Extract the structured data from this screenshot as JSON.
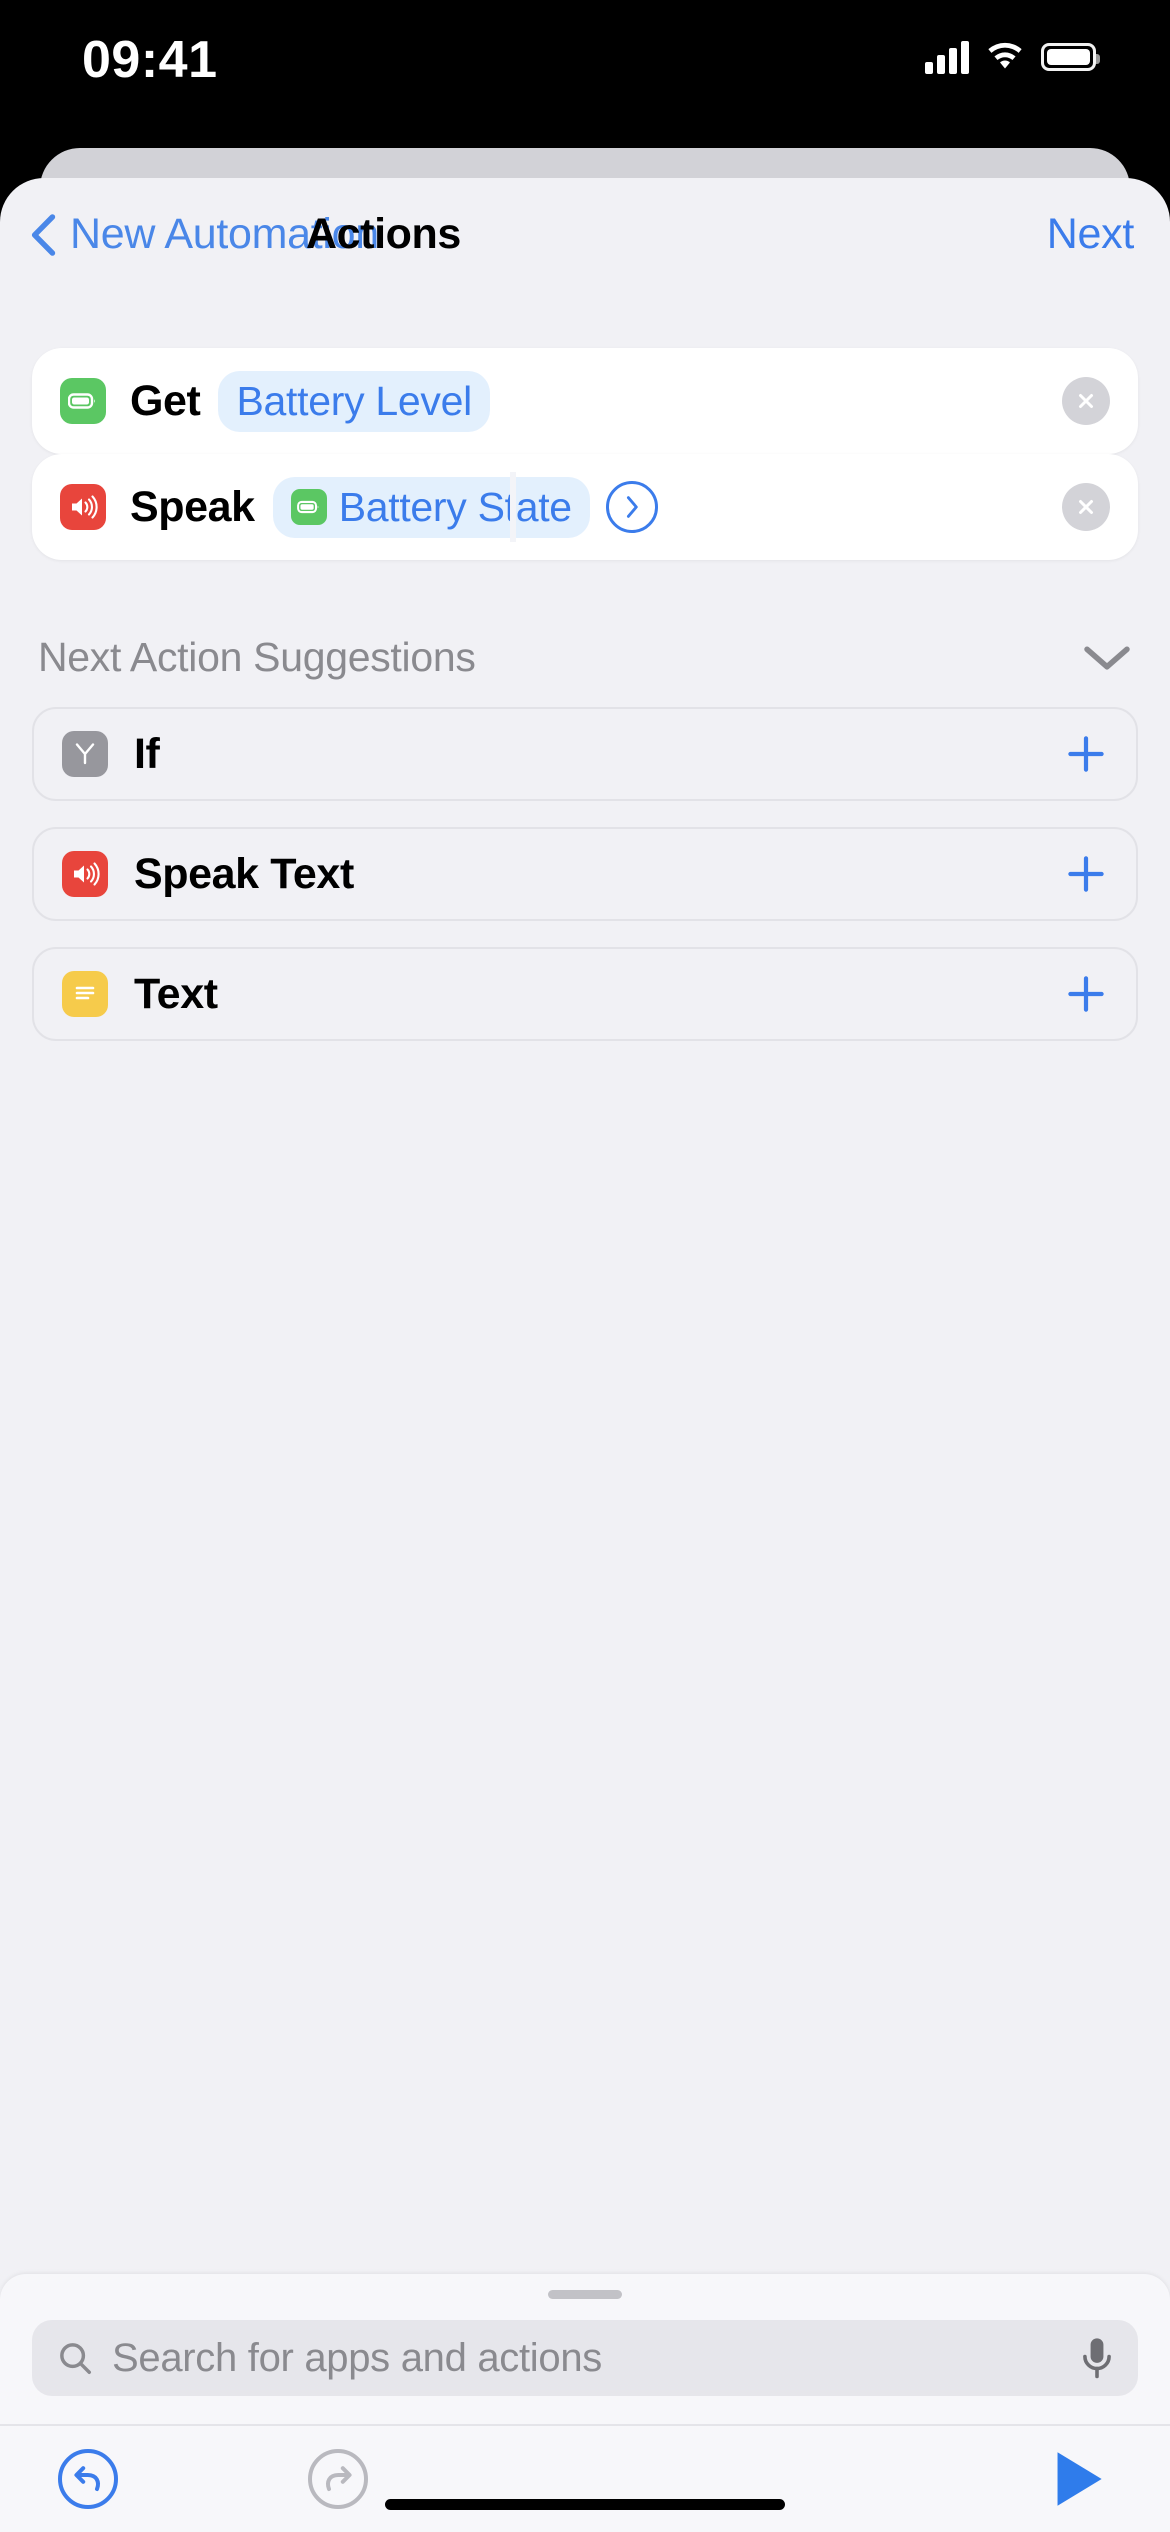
{
  "status_bar": {
    "time": "09:41",
    "signal_icon": "cellular-bars-icon",
    "wifi_icon": "wifi-icon",
    "battery_icon": "battery-full-icon"
  },
  "nav": {
    "back_label": "New Automation",
    "title": "Actions",
    "next_label": "Next",
    "back_icon": "chevron-left-icon",
    "accent_color": "#3b7ceb"
  },
  "actions": [
    {
      "icon": "battery-icon",
      "icon_color": "#5bc763",
      "verb": "Get",
      "token": "Battery Level",
      "token_icon": null,
      "has_disclosure": false,
      "remove_icon": "close-circle-icon"
    },
    {
      "icon": "speaker-wave-icon",
      "icon_color": "#e8453c",
      "verb": "Speak",
      "token": "Battery State",
      "token_icon": "battery-icon",
      "token_icon_color": "#5bc763",
      "has_disclosure": true,
      "disclosure_icon": "chevron-right-circle-icon",
      "remove_icon": "close-circle-icon"
    }
  ],
  "suggestions": {
    "title": "Next Action Suggestions",
    "collapse_icon": "chevron-down-icon",
    "items": [
      {
        "label": "If",
        "icon": "if-branch-icon",
        "icon_color": "#97979d",
        "add_icon": "plus-icon"
      },
      {
        "label": "Speak Text",
        "icon": "speaker-wave-icon",
        "icon_color": "#e8453c",
        "add_icon": "plus-icon"
      },
      {
        "label": "Text",
        "icon": "text-lines-icon",
        "icon_color": "#f6cb4b",
        "add_icon": "plus-icon"
      }
    ]
  },
  "bottom_sheet": {
    "grabber": "sheet-grabber",
    "search": {
      "placeholder": "Search for apps and actions",
      "value": "",
      "search_icon": "search-icon",
      "mic_icon": "microphone-icon"
    },
    "toolbar": {
      "undo_icon": "undo-arrow-icon",
      "redo_icon": "redo-arrow-icon",
      "play_icon": "play-triangle-icon",
      "undo_enabled": true,
      "redo_enabled": false
    }
  }
}
